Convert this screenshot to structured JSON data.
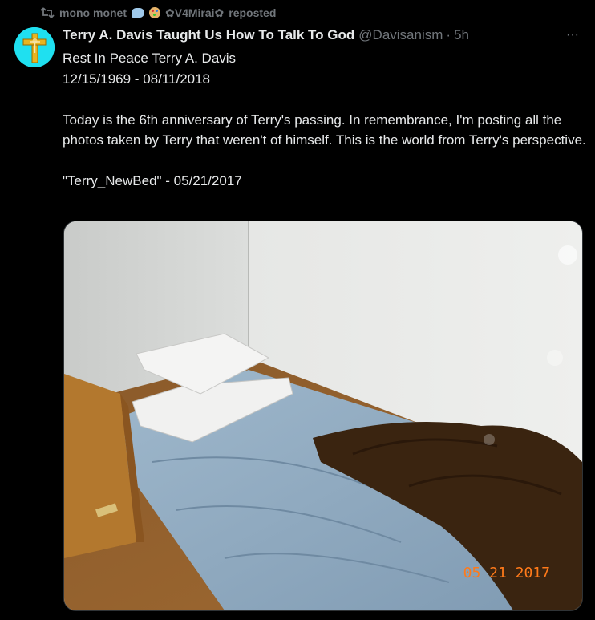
{
  "repost": {
    "reposter_a": "mono monet",
    "reposter_b": "✿V4Mirai✿",
    "suffix": "reposted"
  },
  "tweet": {
    "author_name": "Terry A. Davis Taught Us How To Talk To God",
    "handle": "@Davisanism",
    "separator": "·",
    "time": "5h",
    "more_glyph": "···",
    "text": "Rest In Peace Terry A. Davis\n12/15/1969 - 08/11/2018\n\nToday is the 6th anniversary of Terry's passing. In remembrance, I'm posting all the photos taken by Terry that weren't of himself. This is the world from Terry's perspective.\n\n\"Terry_NewBed\" - 05/21/2017"
  },
  "photo": {
    "date_stamp": "05 21 2017"
  },
  "colors": {
    "background": "#000000",
    "text": "#e7e9ea",
    "secondary": "#71767b",
    "avatar": "#1fe0f0",
    "date_stamp": "#ff7a1a"
  },
  "icons": {
    "repost": "repost-icon",
    "more": "more-icon",
    "avatar": "golden-cross-icon"
  }
}
